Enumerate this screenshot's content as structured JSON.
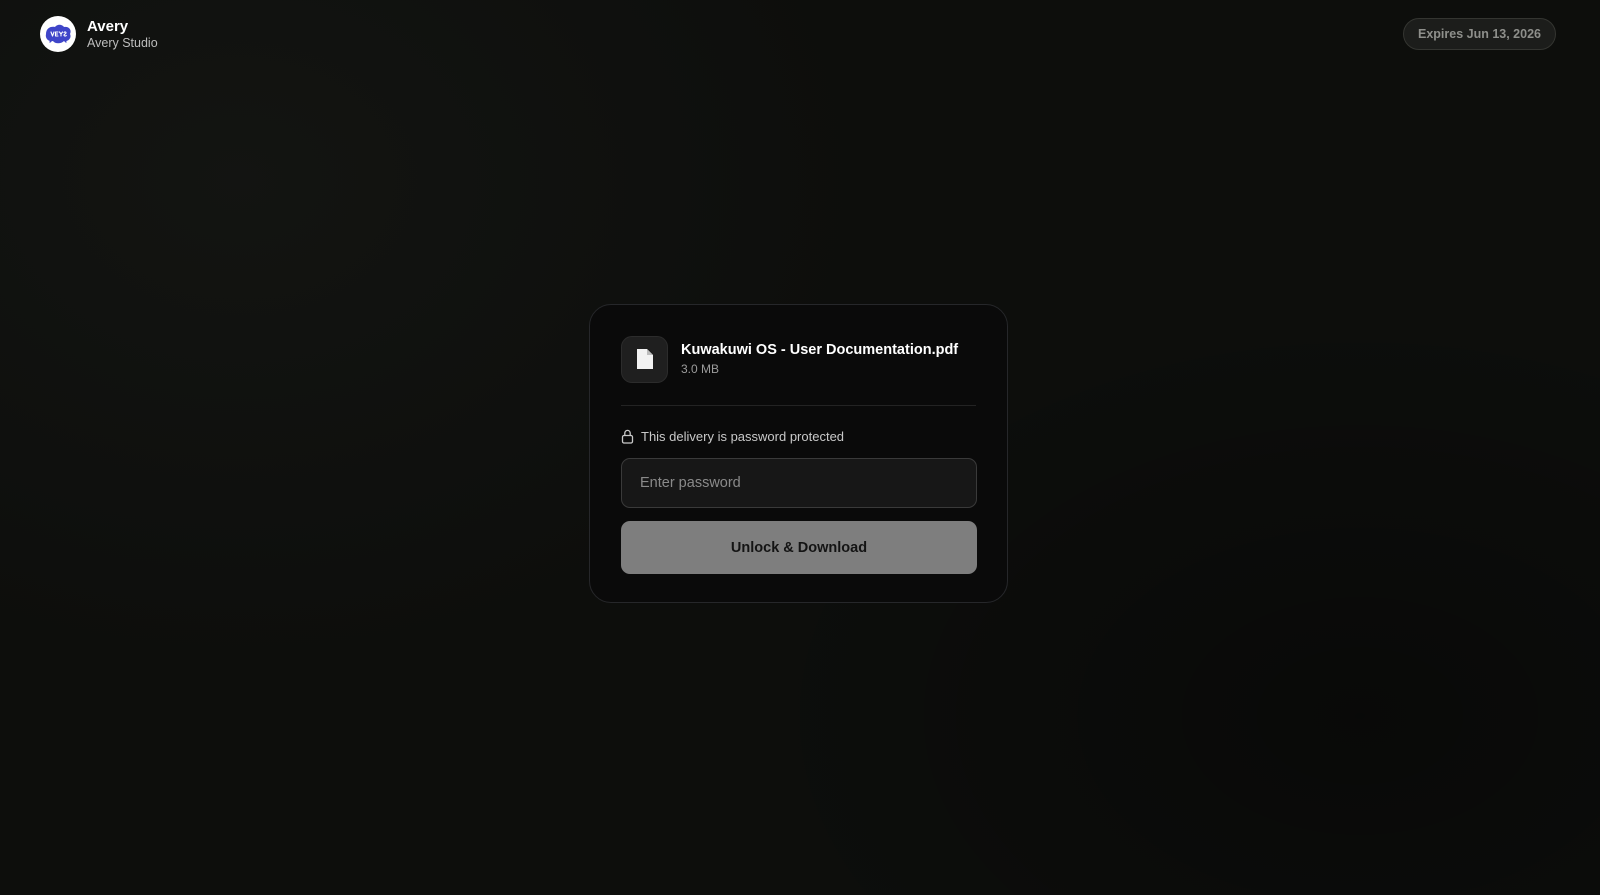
{
  "brand": {
    "name": "Avery",
    "subtitle": "Avery Studio",
    "logo_icon": "avery-logo-icon"
  },
  "expiry": {
    "label": "Expires Jun 13, 2026"
  },
  "file": {
    "icon": "document-icon",
    "name": "Kuwakuwi OS - User Documentation.pdf",
    "size": "3.0 MB"
  },
  "protection": {
    "icon": "lock-icon",
    "text": "This delivery is password protected"
  },
  "password": {
    "placeholder": "Enter password",
    "value": ""
  },
  "actions": {
    "unlock_label": "Unlock & Download"
  },
  "colors": {
    "background": "#0d0e0c",
    "card": "#0a0a0a",
    "button": "#7e7e7e",
    "logo_accent": "#3f45c9"
  }
}
